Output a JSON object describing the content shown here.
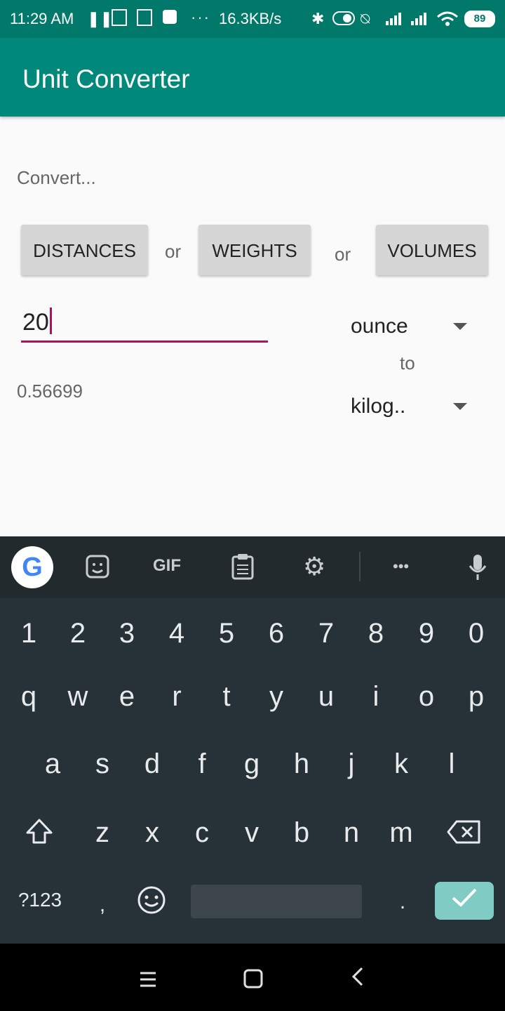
{
  "status": {
    "time": "11:29 AM",
    "speed": "16.3KB/s",
    "dots": "···",
    "battery": "89"
  },
  "app": {
    "title": "Unit Converter"
  },
  "converter": {
    "prompt": "Convert...",
    "buttons": [
      "DISTANCES",
      "WEIGHTS",
      "VOLUMES"
    ],
    "or": "or",
    "input_value": "20",
    "from_unit": "ounce",
    "to_label": "to",
    "to_unit": "kilog..",
    "result": "0.56699"
  },
  "keyboard": {
    "toolbar_gif": "GIF",
    "toolbar_more": "•••",
    "row_numbers": [
      "1",
      "2",
      "3",
      "4",
      "5",
      "6",
      "7",
      "8",
      "9",
      "0"
    ],
    "row1": [
      "q",
      "w",
      "e",
      "r",
      "t",
      "y",
      "u",
      "i",
      "o",
      "p"
    ],
    "row2": [
      "a",
      "s",
      "d",
      "f",
      "g",
      "h",
      "j",
      "k",
      "l"
    ],
    "row3": [
      "z",
      "x",
      "c",
      "v",
      "b",
      "n",
      "m"
    ],
    "symbols_key": "?123",
    "comma": ",",
    "period": ".",
    "enter_icon": "checkmark-icon"
  },
  "icons": {
    "pause": "pause-icon",
    "sim": "sim-icon",
    "bluetooth": "bluetooth-icon",
    "wifi": "wifi-icon",
    "google": "google-icon",
    "sticker": "sticker-icon",
    "clipboard": "clipboard-icon",
    "settings": "gear-icon",
    "mic": "mic-icon",
    "shift": "shift-icon",
    "backspace": "backspace-icon",
    "emoji": "emoji-icon"
  },
  "colors": {
    "app_bar": "#00897b",
    "status_bar": "#00796b",
    "accent": "#ad1457",
    "keyboard_bg": "#263238",
    "enter_key": "#80cbc4"
  }
}
